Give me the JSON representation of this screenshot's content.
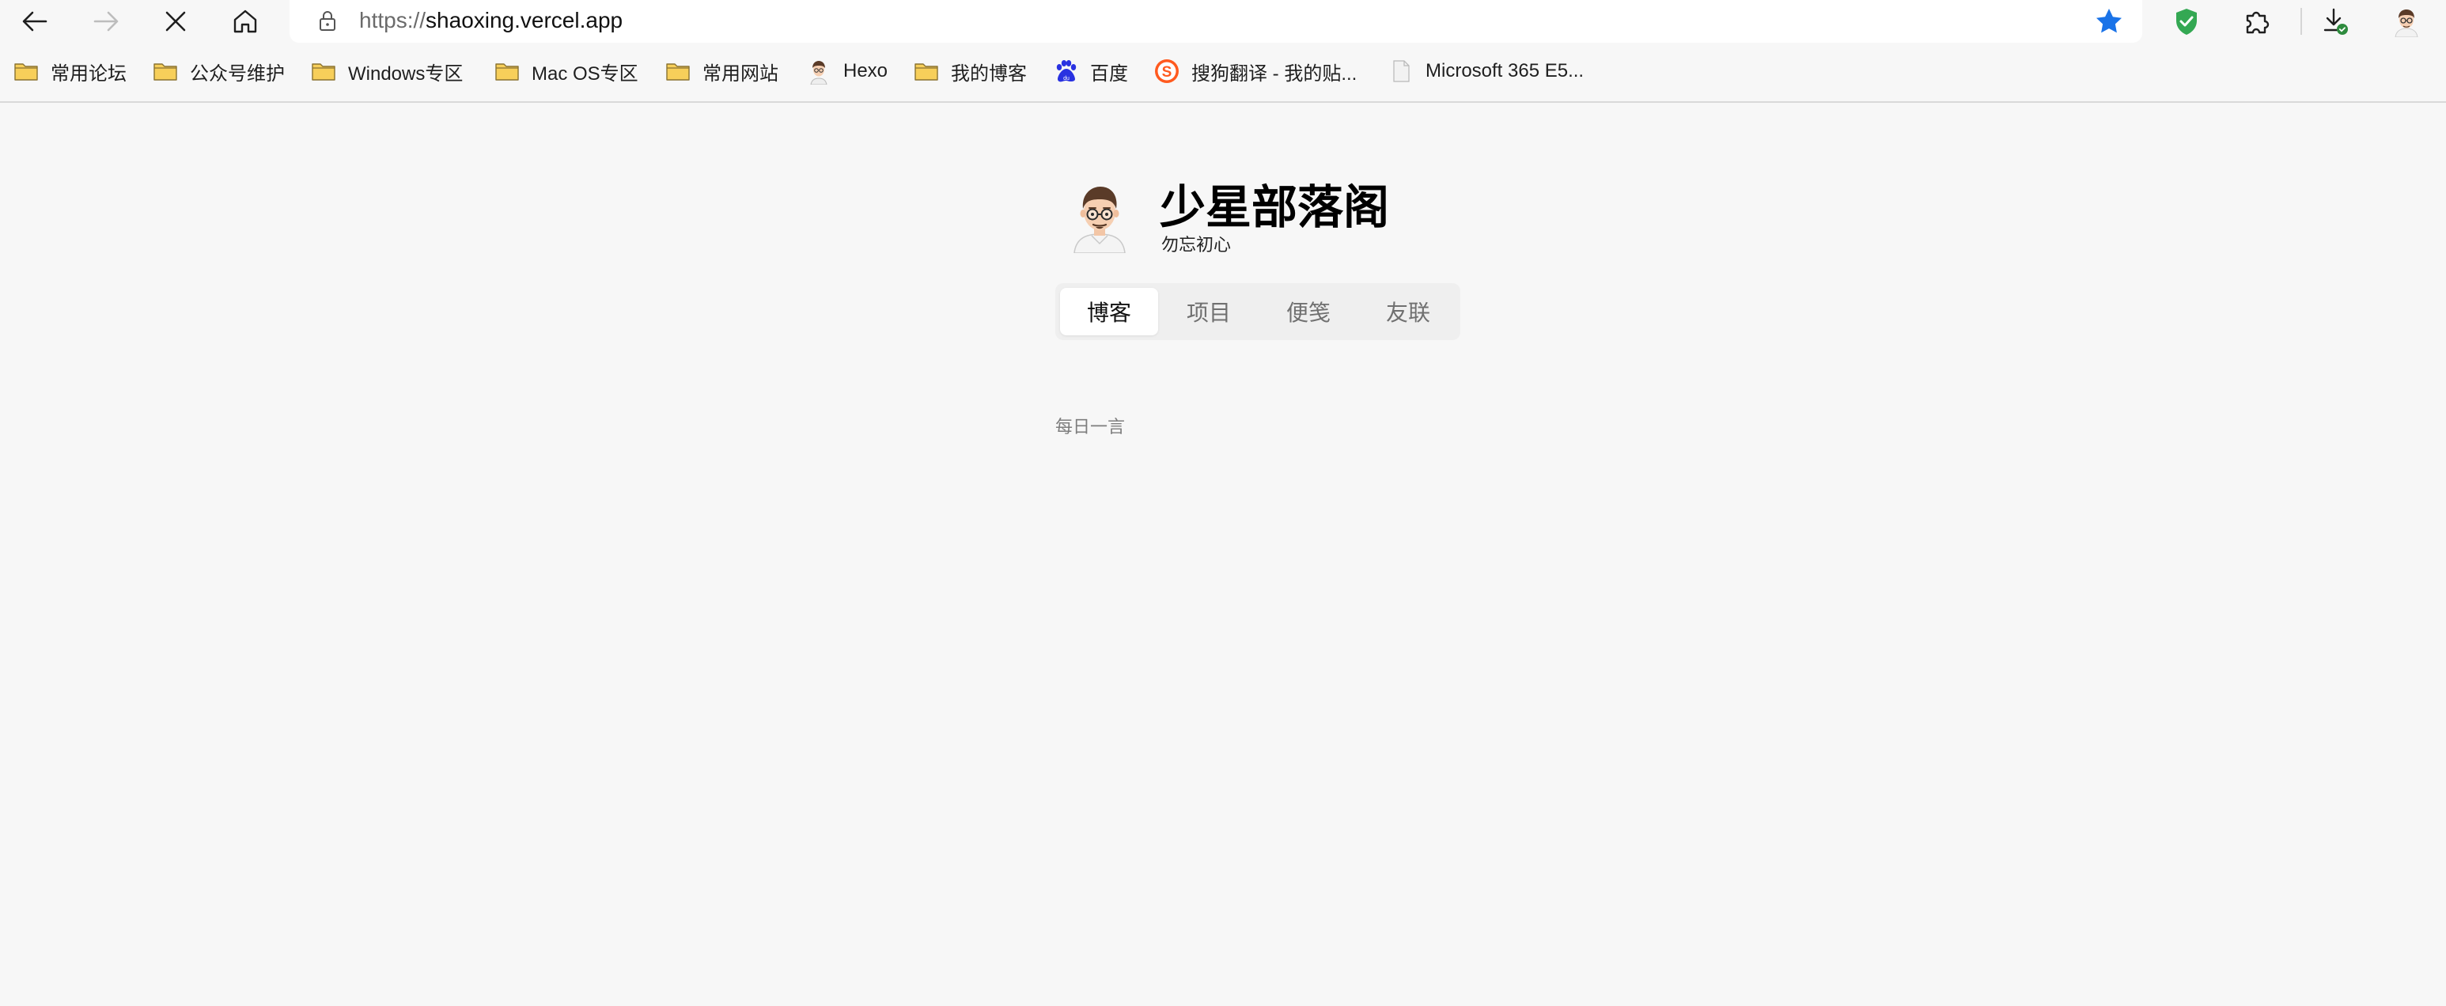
{
  "browser": {
    "address": {
      "scheme": "https://",
      "host": "shaoxing.vercel.app"
    },
    "nav": {
      "back": "arrow-left-icon",
      "forward": "arrow-right-icon",
      "stop": "close-icon",
      "home": "home-icon"
    },
    "colors": {
      "star": "#1a73e8",
      "shield": "#34a853",
      "folder": "#f7cf5a",
      "baidu": "#2932e1",
      "sogou": "#ff5a1f"
    }
  },
  "bookmarks": [
    {
      "label": "常用论坛",
      "icon": "folder-icon"
    },
    {
      "label": "公众号维护",
      "icon": "folder-icon"
    },
    {
      "label": "Windows专区",
      "icon": "folder-icon"
    },
    {
      "label": "Mac OS专区",
      "icon": "folder-icon"
    },
    {
      "label": "常用网站",
      "icon": "folder-icon"
    },
    {
      "label": "Hexo",
      "icon": "avatar-icon"
    },
    {
      "label": "我的博客",
      "icon": "folder-icon"
    },
    {
      "label": "百度",
      "icon": "baidu-paw-icon"
    },
    {
      "label": "搜狗翻译 - 我的贴...",
      "icon": "sogou-icon"
    },
    {
      "label": "Microsoft 365 E5...",
      "icon": "page-icon"
    }
  ],
  "site": {
    "title": "少星部落阁",
    "subtitle": "勿忘初心",
    "tabs": [
      "博客",
      "项目",
      "便笺",
      "友联"
    ],
    "active_tab": "博客",
    "section_label": "每日一言"
  }
}
